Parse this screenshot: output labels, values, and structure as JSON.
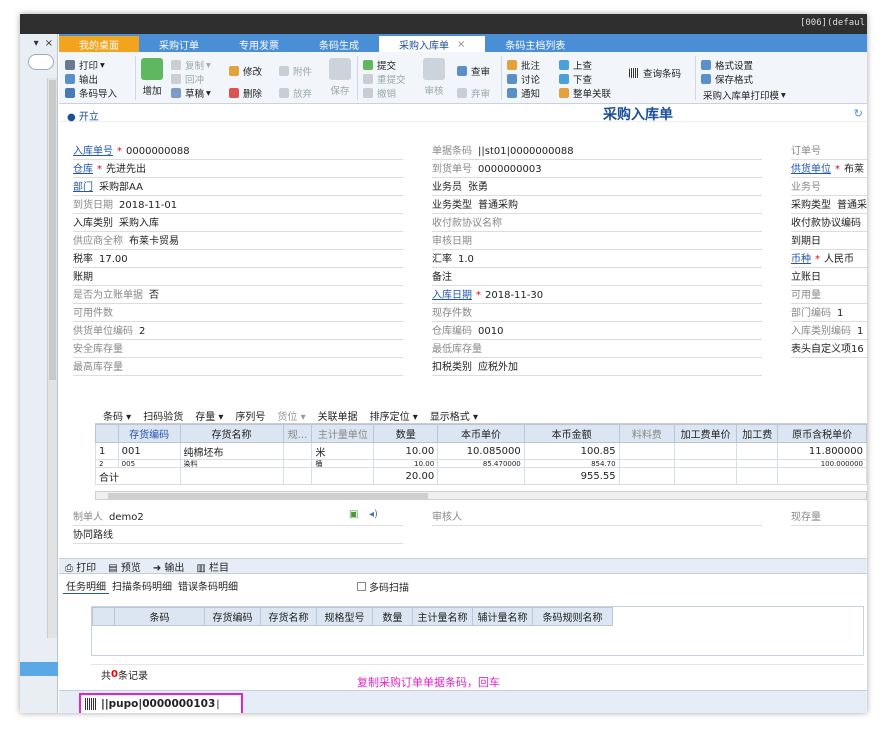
{
  "window": {
    "title_text": "[006](defaul"
  },
  "left_pane": {
    "close_glyph": "×",
    "pin_glyph": "▾"
  },
  "tabs": [
    {
      "label": "我的桌面"
    },
    {
      "label": "采购订单"
    },
    {
      "label": "专用发票"
    },
    {
      "label": "条码生成"
    },
    {
      "label": "采购入库单"
    },
    {
      "label": "条码主档列表"
    }
  ],
  "ribbon": {
    "print": "打印",
    "export": "输出",
    "barcode_import": "条码导入",
    "add": "增加",
    "copy": "复制",
    "write_back": "回冲",
    "draft": "草稿",
    "modify": "修改",
    "delete": "删除",
    "attach": "附件",
    "discard": "放弃",
    "save": "保存",
    "submit": "提交",
    "resubmit": "重提交",
    "withdraw": "撤销",
    "audit": "审核",
    "query_audit": "查审",
    "abandon_audit": "弃审",
    "approve": "批注",
    "discuss": "讨论",
    "notify": "通知",
    "up": "上查",
    "down": "下查",
    "whole_link": "整单关联",
    "query_barcode": "查询条码",
    "format_settings": "格式设置",
    "save_format": "保存格式",
    "print_template": "采购入库单打印模"
  },
  "form": {
    "open": "开立",
    "title": "采购入库单",
    "fields": {
      "rk_no": {
        "label": "入库单号",
        "value": "0000000088"
      },
      "warehouse": {
        "label": "仓库",
        "value": "先进先出"
      },
      "dept": {
        "label": "部门",
        "value": "采购部AA"
      },
      "arrive_date": {
        "label": "到货日期",
        "value": "2018-11-01"
      },
      "rk_type": {
        "label": "入库类别",
        "value": "采购入库"
      },
      "supplier_full": {
        "label": "供应商全称",
        "value": "布莱卡贸易"
      },
      "tax_rate": {
        "label": "税率",
        "value": "17.00"
      },
      "account_period": {
        "label": "账期",
        "value": ""
      },
      "is_account": {
        "label": "是否为立账单据",
        "value": "否"
      },
      "avail_qty": {
        "label": "可用件数",
        "value": ""
      },
      "supplier_code": {
        "label": "供货单位编码",
        "value": "2"
      },
      "safety_stock": {
        "label": "安全库存量",
        "value": ""
      },
      "max_stock": {
        "label": "最高库存量",
        "value": ""
      },
      "doc_barcode": {
        "label": "单据条码",
        "value": "||st01|0000000088"
      },
      "arrive_no": {
        "label": "到货单号",
        "value": "0000000003"
      },
      "salesman": {
        "label": "业务员",
        "value": "张勇"
      },
      "biz_type": {
        "label": "业务类型",
        "value": "普通采购"
      },
      "pay_protocol": {
        "label": "收付款协议名称",
        "value": ""
      },
      "audit_date": {
        "label": "审核日期",
        "value": ""
      },
      "exchange_rate": {
        "label": "汇率",
        "value": "1.0"
      },
      "remark": {
        "label": "备注",
        "value": ""
      },
      "rk_date": {
        "label": "入库日期",
        "value": "2018-11-30"
      },
      "stock_qty": {
        "label": "现存件数",
        "value": ""
      },
      "wh_code": {
        "label": "仓库编码",
        "value": "0010"
      },
      "min_stock": {
        "label": "最低库存量",
        "value": ""
      },
      "tax_type": {
        "label": "扣税类别",
        "value": "应税外加"
      },
      "order_no": {
        "label": "订单号",
        "value": ""
      },
      "supply_unit": {
        "label": "供货单位",
        "value": "布莱"
      },
      "biz_no": {
        "label": "业务号",
        "value": ""
      },
      "purchase_type": {
        "label": "采购类型",
        "value": "普通采"
      },
      "pay_protocol_code": {
        "label": "收付款协议编码",
        "value": ""
      },
      "due_date": {
        "label": "到期日",
        "value": ""
      },
      "currency": {
        "label": "币种",
        "value": "人民币"
      },
      "account_date": {
        "label": "立账日",
        "value": ""
      },
      "avail_amount": {
        "label": "可用量",
        "value": ""
      },
      "dept_code": {
        "label": "部门编码",
        "value": "1"
      },
      "rk_type_code": {
        "label": "入库类别编码",
        "value": "1"
      },
      "custom16": {
        "label": "表头自定义项16",
        "value": ""
      }
    }
  },
  "grid_toolbar": [
    "条码",
    "扫码验货",
    "存量",
    "序列号",
    "货位",
    "关联单据",
    "排序定位",
    "显示格式"
  ],
  "grid": {
    "headers": [
      "",
      "存货编码",
      "存货名称",
      "规...",
      "主计量单位",
      "数量",
      "本币单价",
      "本币金额",
      "料料费",
      "加工费单价",
      "加工费",
      "原币含税单价"
    ],
    "rows": [
      [
        "1",
        "001",
        "纯棉坯布",
        "",
        "米",
        "10.00",
        "10.085000",
        "100.85",
        "",
        "",
        "",
        "11.800000"
      ],
      [
        "2",
        "005",
        "染料",
        "",
        "桶",
        "10.00",
        "85.470000",
        "854.70",
        "",
        "",
        "",
        "100.000000"
      ]
    ],
    "total_label": "合计",
    "total_qty": "20.00",
    "total_amount": "955.55"
  },
  "footer_fields": {
    "maker": {
      "label": "制单人",
      "value": "demo2"
    },
    "auditor": {
      "label": "审核人",
      "value": ""
    },
    "stock_qty": {
      "label": "现存量",
      "value": ""
    },
    "flow": {
      "label": "协同路线",
      "value": ""
    }
  },
  "bottom_toolbar": {
    "print": "打印",
    "preview": "预览",
    "export": "输出",
    "columns": "栏目"
  },
  "sub_tabs": [
    "任务明细",
    "扫描条码明细",
    "错误条码明细"
  ],
  "multi_scan": "多码扫描",
  "barcode_grid": {
    "headers": [
      "条码",
      "存货编码",
      "存货名称",
      "规格型号",
      "数量",
      "主计量名称",
      "辅计量名称",
      "条码规则名称"
    ],
    "footer_prefix": "共",
    "count": "0",
    "footer_suffix": "条记录"
  },
  "hint": "复制采购订单单据条码，回车",
  "scan_input": {
    "value": "||pupo|0000000103"
  }
}
